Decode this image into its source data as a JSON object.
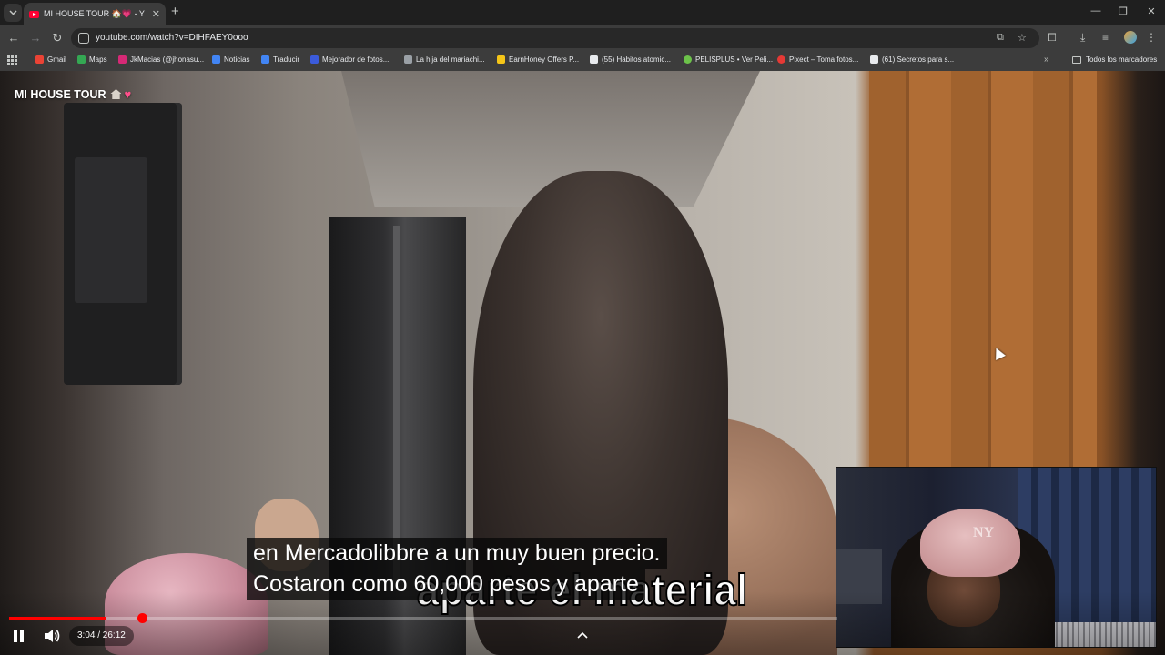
{
  "browser": {
    "tab": {
      "title": "MI HOUSE TOUR 🏠💗 - Y"
    },
    "address_bar": {
      "url": "youtube.com/watch?v=DIHFAEY0ooo"
    },
    "bookmarks": [
      {
        "label": "Gmail",
        "icon": "gmail-icon",
        "color": "#ea4335"
      },
      {
        "label": "Maps",
        "icon": "maps-icon",
        "color": "#34a853"
      },
      {
        "label": "JkMacias (@jhonasu...",
        "icon": "instagram-icon",
        "color": "#d62976"
      },
      {
        "label": "Noticias",
        "icon": "news-icon",
        "color": "#4285f4"
      },
      {
        "label": "Traducir",
        "icon": "translate-icon",
        "color": "#4285f4"
      },
      {
        "label": "Mejorador de fotos...",
        "icon": "photo-enhancer-icon",
        "color": "#3b5bdb"
      },
      {
        "label": "La hija del mariachi...",
        "icon": "video-icon",
        "color": "#9aa0a6"
      },
      {
        "label": "EarnHoney Offers P...",
        "icon": "earnhoney-icon",
        "color": "#f5c518"
      },
      {
        "label": "(55) Habitos atomic...",
        "icon": "a-icon",
        "color": "#e8eaed"
      },
      {
        "label": "PELISPLUS • Ver Peli...",
        "icon": "pelisplus-icon",
        "color": "#6cc24a"
      },
      {
        "label": "Pixect – Toma fotos...",
        "icon": "pixect-icon",
        "color": "#e53935"
      },
      {
        "label": "(61) Secretos para s...",
        "icon": "a-icon",
        "color": "#e8eaed"
      }
    ],
    "all_bookmarks_label": "Todos los marcadores"
  },
  "video": {
    "title": "MI HOUSE TOUR",
    "title_emojis": "🏠💗",
    "burned_caption": "aparte el material",
    "subtitles": [
      "en Mercadolibbre a un muy buen precio.",
      "Costaron como 60,000 pesos y aparte"
    ],
    "webcam_cap_logo": "NY",
    "player": {
      "time_display": "3:04 / 26:12",
      "progress_fraction": 0.1175,
      "accent_color": "#ff0000"
    }
  }
}
